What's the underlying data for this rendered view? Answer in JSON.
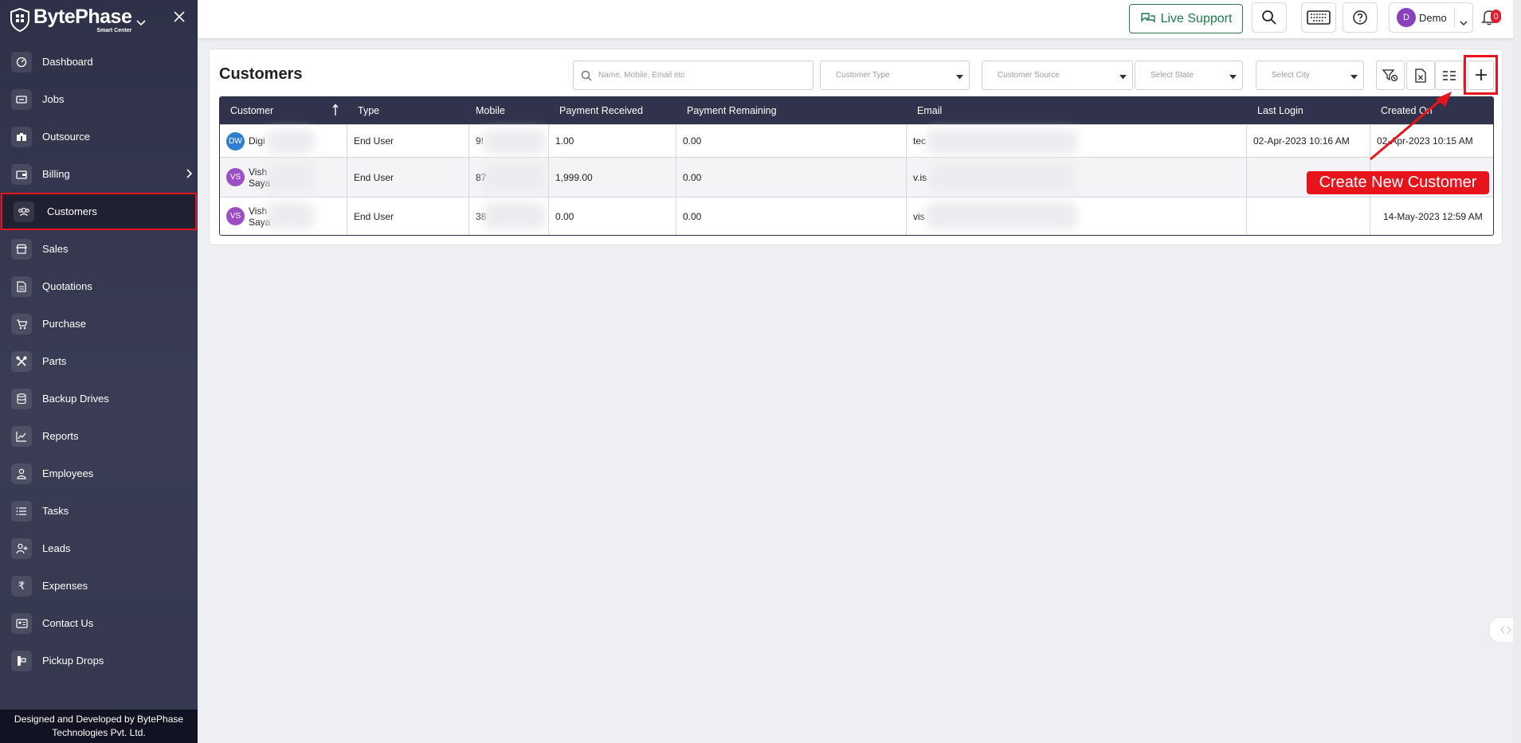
{
  "brand": {
    "name": "BytePhase",
    "subtitle": "Smart Center"
  },
  "sidebar": {
    "items": [
      {
        "label": "Dashboard",
        "icon": "dashboard-icon"
      },
      {
        "label": "Jobs",
        "icon": "jobs-icon"
      },
      {
        "label": "Outsource",
        "icon": "outsource-icon"
      },
      {
        "label": "Billing",
        "icon": "billing-icon"
      },
      {
        "label": "Customers",
        "icon": "customers-icon",
        "active": true
      },
      {
        "label": "Sales",
        "icon": "sales-icon"
      },
      {
        "label": "Quotations",
        "icon": "quotations-icon"
      },
      {
        "label": "Purchase",
        "icon": "purchase-icon"
      },
      {
        "label": "Parts",
        "icon": "parts-icon"
      },
      {
        "label": "Backup Drives",
        "icon": "database-icon"
      },
      {
        "label": "Reports",
        "icon": "reports-icon"
      },
      {
        "label": "Employees",
        "icon": "employees-icon"
      },
      {
        "label": "Tasks",
        "icon": "tasks-icon"
      },
      {
        "label": "Leads",
        "icon": "leads-icon"
      },
      {
        "label": "Expenses",
        "icon": "rupee-icon"
      },
      {
        "label": "Contact Us",
        "icon": "contact-icon"
      },
      {
        "label": "Pickup Drops",
        "icon": "pickup-icon"
      }
    ],
    "footer": "Designed and Developed by BytePhase Technologies Pvt. Ltd."
  },
  "topbar": {
    "live_support": "Live Support",
    "user": {
      "initial": "D",
      "name": "Demo"
    },
    "notifications": "0"
  },
  "main": {
    "title": "Customers",
    "search_placeholder": "Name, Mobile, Email etc",
    "filters": {
      "customer_type": "Customer Type",
      "customer_source": "Customer Source",
      "state": "Select State",
      "city": "Select City"
    },
    "table": {
      "columns": [
        "Customer",
        "Type",
        "Mobile",
        "Payment Received",
        "Payment Remaining",
        "Email",
        "Last Login",
        "Created On"
      ],
      "rows": [
        {
          "initials": "DW",
          "avatar_color": "#2f7fd0",
          "name": "Digi",
          "type": "End User",
          "mobile": "9!",
          "received": "1.00",
          "remaining": "0.00",
          "email": "tec",
          "last_login": "02-Apr-2023 10:16 AM",
          "created_on": "02-Apr-2023 10:15 AM"
        },
        {
          "initials": "VS",
          "avatar_color": "#9c4fc4",
          "name": "Vish Saya",
          "type": "End User",
          "mobile": "87",
          "received": "1,999.00",
          "remaining": "0.00",
          "email": "v.is",
          "last_login": "",
          "created_on": ""
        },
        {
          "initials": "VS",
          "avatar_color": "#9c4fc4",
          "name": "Vish Saya",
          "type": "End User",
          "mobile": "38",
          "received": "0.00",
          "remaining": "0.00",
          "email": "vis",
          "last_login": "",
          "created_on": "14-May-2023 12:59 AM"
        }
      ]
    }
  },
  "annotation": {
    "label": "Create New Customer",
    "color": "#e8141c"
  }
}
